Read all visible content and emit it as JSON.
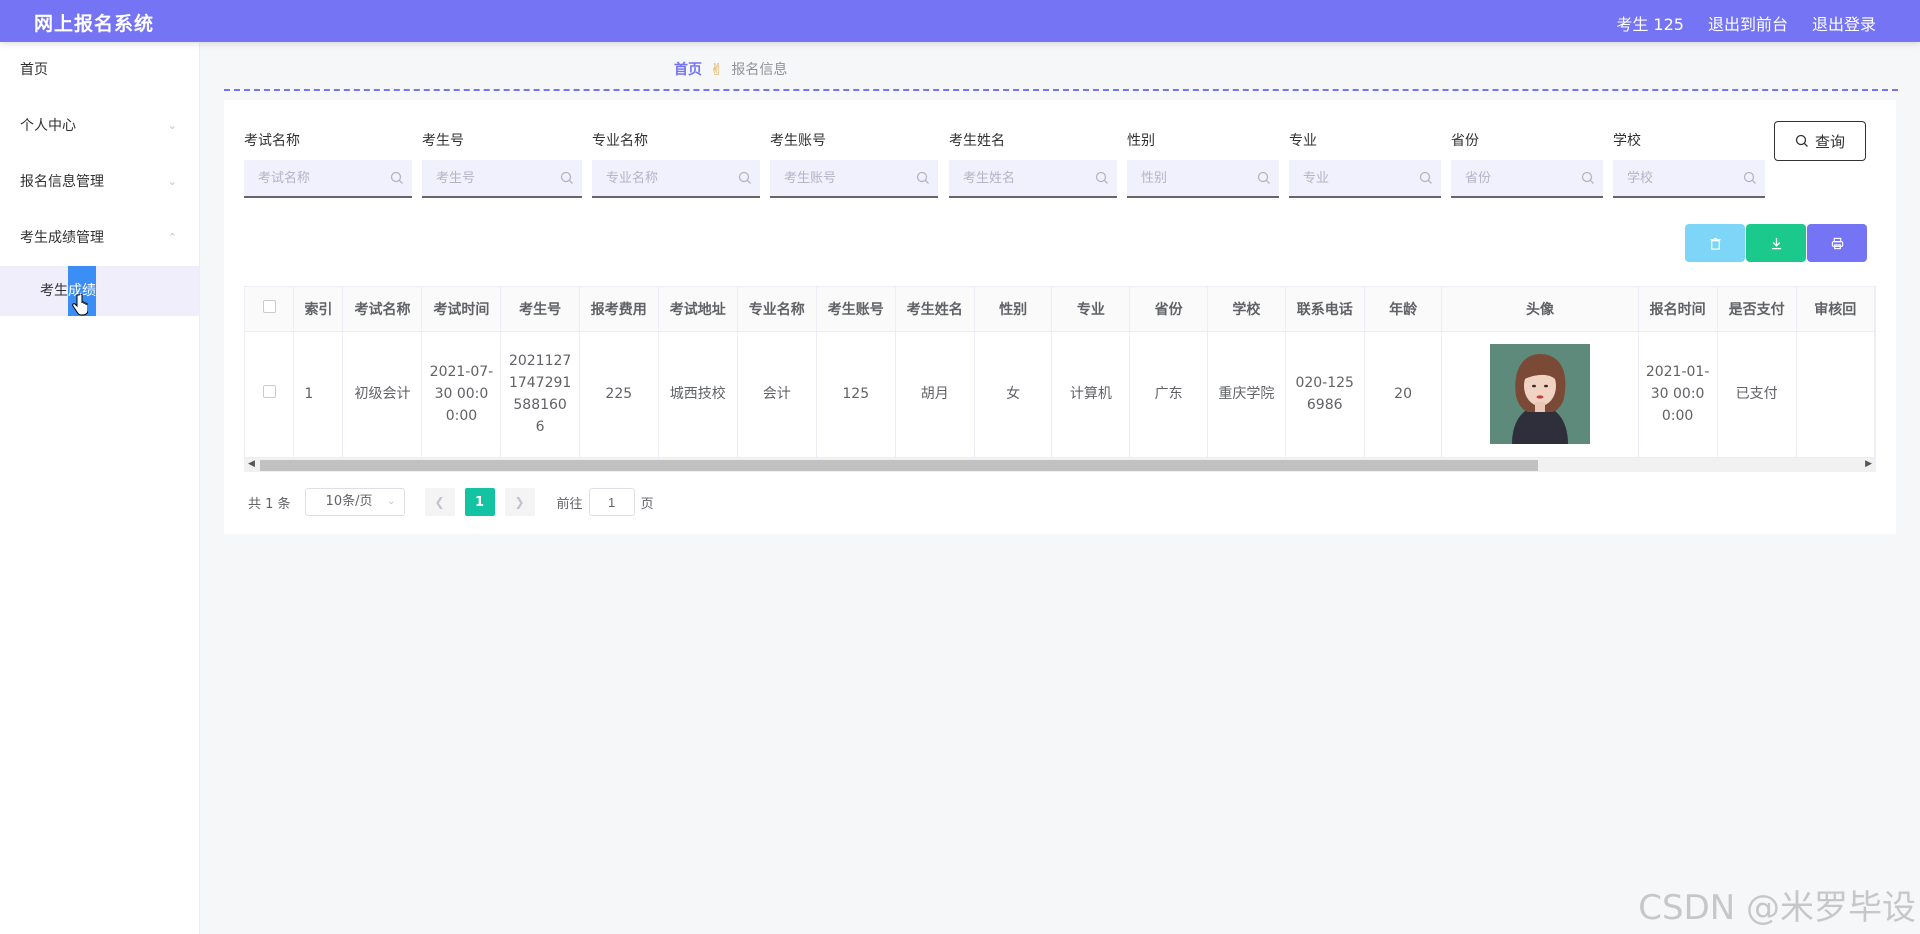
{
  "header": {
    "title": "网上报名系统",
    "user": "考生 125",
    "front_link": "退出到前台",
    "logout_link": "退出登录"
  },
  "sidebar": {
    "items": [
      {
        "label": "首页"
      },
      {
        "label": "个人中心"
      },
      {
        "label": "报名信息管理"
      },
      {
        "label": "考生成绩管理"
      }
    ],
    "sub_item_prefix": "考生",
    "sub_item_highlight": "成绩"
  },
  "breadcrumb": {
    "home": "首页",
    "current": "报名信息"
  },
  "search": {
    "fields": [
      {
        "label": "考试名称",
        "placeholder": "考试名称"
      },
      {
        "label": "考生号",
        "placeholder": "考生号"
      },
      {
        "label": "专业名称",
        "placeholder": "专业名称"
      },
      {
        "label": "考生账号",
        "placeholder": "考生账号"
      },
      {
        "label": "考生姓名",
        "placeholder": "考生姓名"
      },
      {
        "label": "性别",
        "placeholder": "性别"
      },
      {
        "label": "专业",
        "placeholder": "专业"
      },
      {
        "label": "省份",
        "placeholder": "省份"
      },
      {
        "label": "学校",
        "placeholder": "学校"
      }
    ],
    "query_label": "查询"
  },
  "table": {
    "columns": [
      "索引",
      "考试名称",
      "考试时间",
      "考生号",
      "报考费用",
      "考试地址",
      "专业名称",
      "考生账号",
      "考生姓名",
      "性别",
      "专业",
      "省份",
      "学校",
      "联系电话",
      "年龄",
      "头像",
      "报名时间",
      "是否支付",
      "审核回"
    ],
    "rows": [
      [
        "1",
        "初级会计",
        "2021-07-30 00:00:00",
        "20211271747291588160 6",
        "225",
        "城西技校",
        "会计",
        "125",
        "胡月",
        "女",
        "计算机",
        "广东",
        "重庆学院",
        "020-1256986",
        "20",
        "",
        "2021-01-30 00:00:00",
        "已支付",
        ""
      ]
    ]
  },
  "pagination": {
    "total": "共 1 条",
    "page_size": "10条/页",
    "current_page": "1",
    "goto_prefix": "前往",
    "goto_value": "1",
    "goto_suffix": "页"
  },
  "watermark": "CSDN @米罗毕设",
  "colors": {
    "primary": "#7474f5",
    "success": "#1cc98d",
    "info": "#7dd6f7",
    "page_active": "#13c3a1"
  }
}
